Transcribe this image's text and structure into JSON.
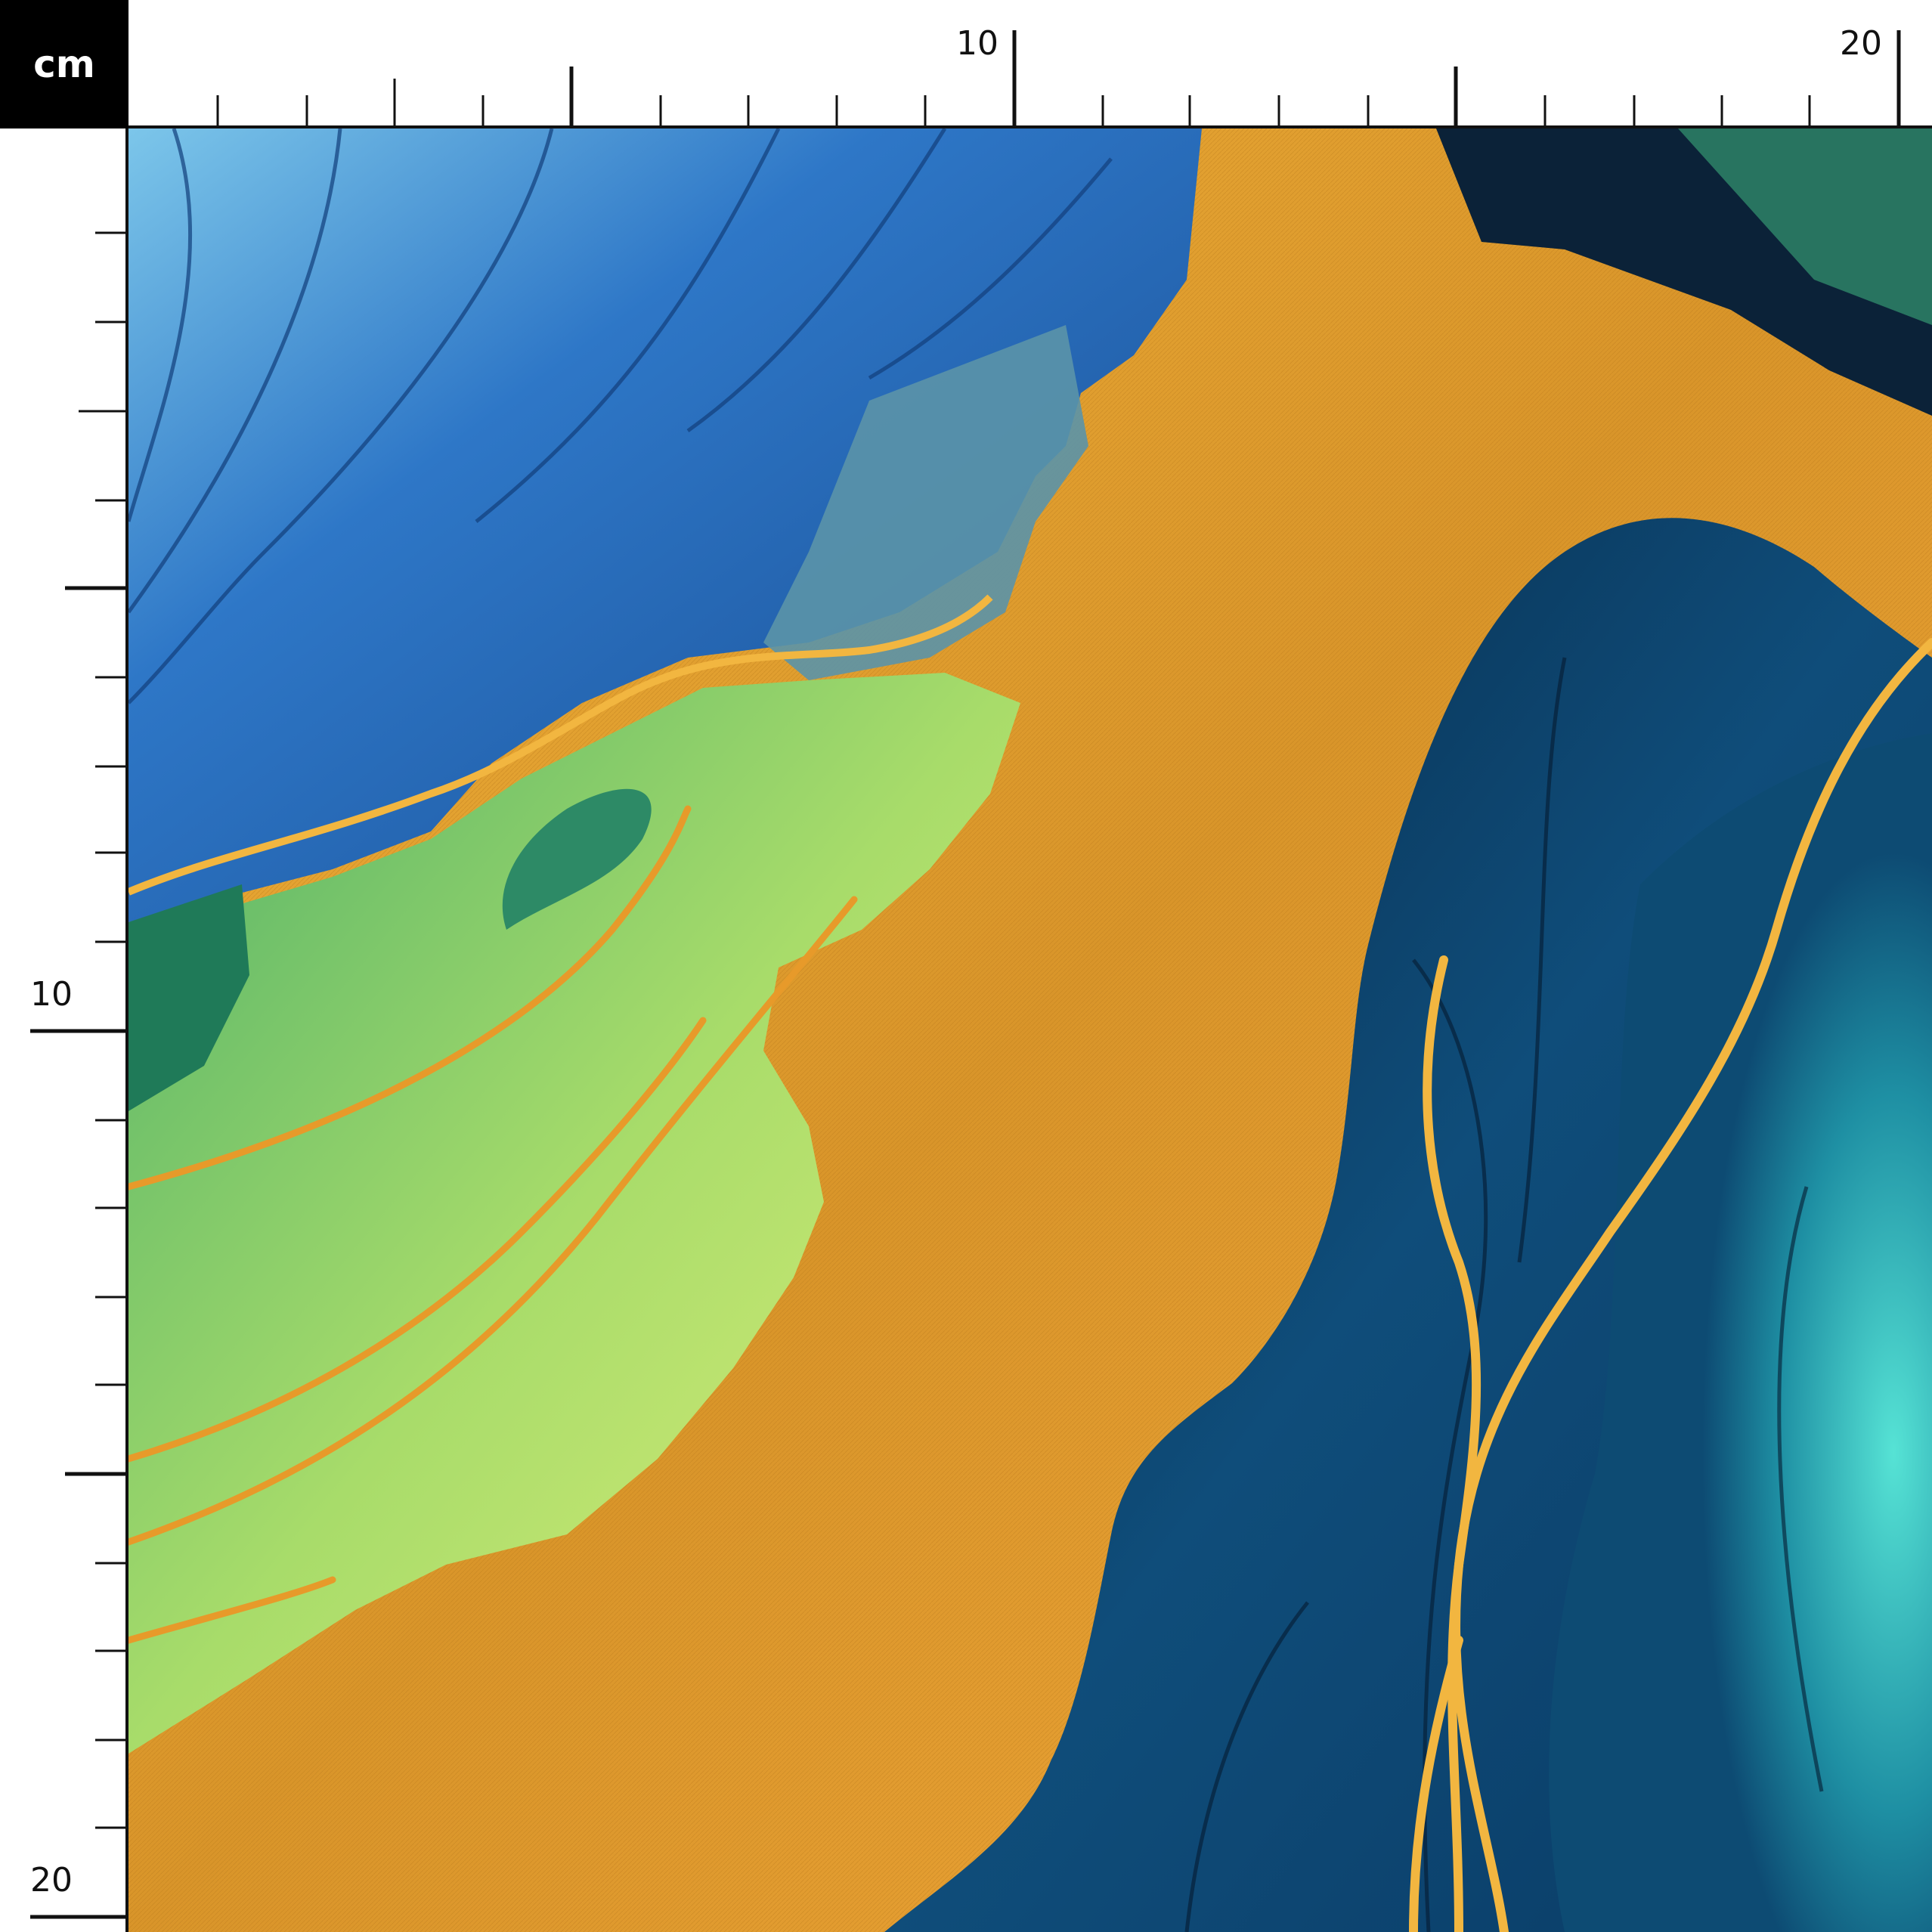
{
  "ruler": {
    "unit": "cm",
    "top_labels": [
      "10",
      "20"
    ],
    "left_labels": [
      "10",
      "20"
    ]
  },
  "swatch": {
    "description_colors": {
      "deep_blue": "#1f5fa8",
      "light_blue": "#6fb8e0",
      "navy": "#0b2f55",
      "teal": "#1a7f94",
      "aqua": "#3fd6d0",
      "green": "#5cbf4a",
      "lime": "#d8ee6a",
      "gold": "#e6a531",
      "gold_line": "#f2b640"
    }
  }
}
